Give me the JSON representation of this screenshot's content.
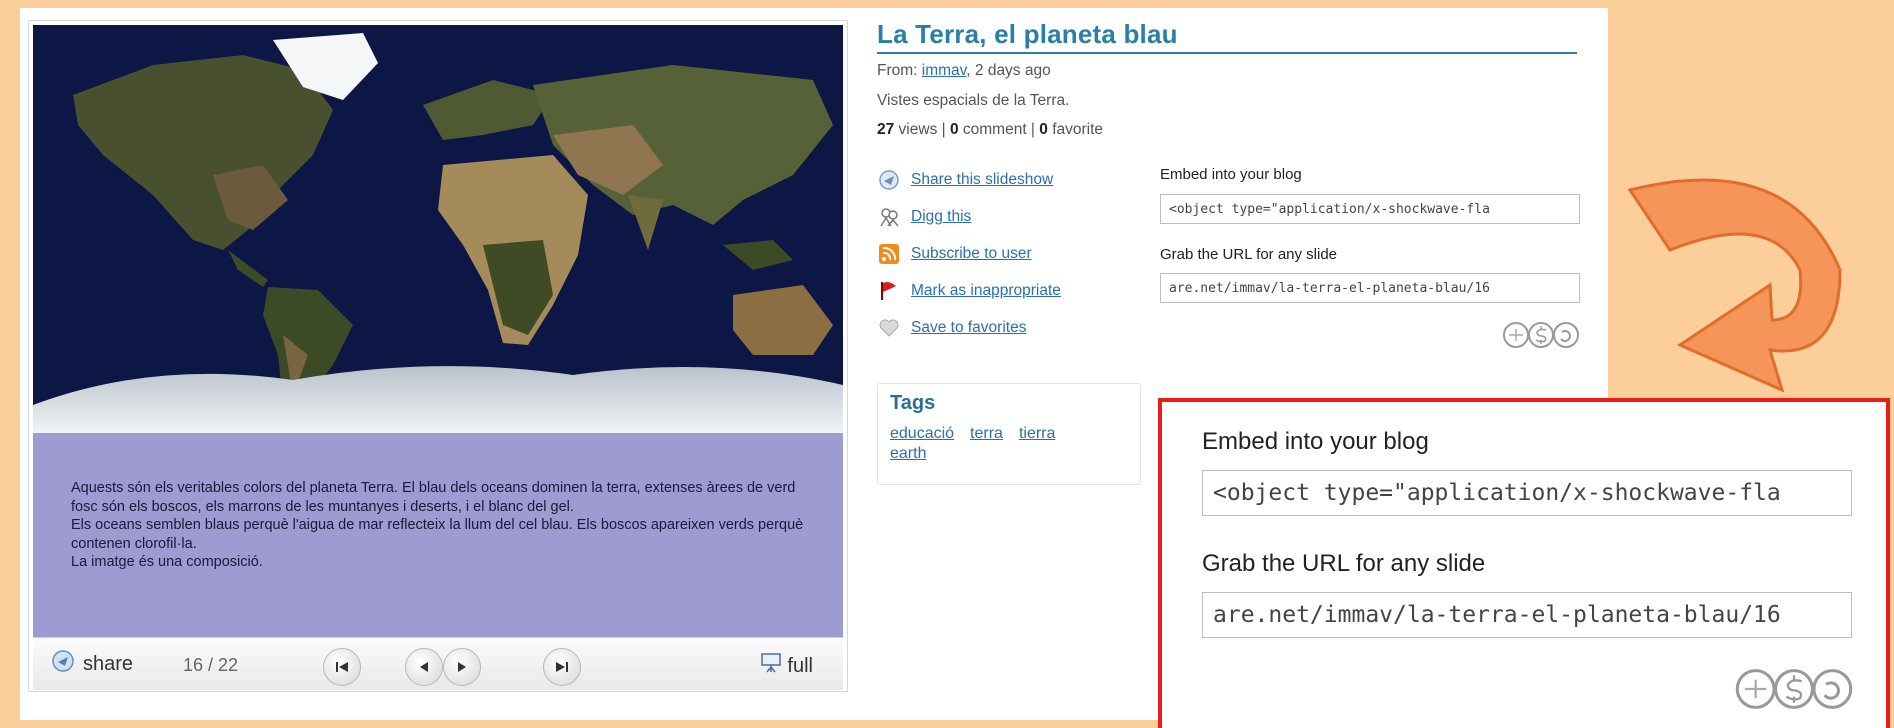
{
  "title": "La Terra, el planeta blau",
  "meta": {
    "from_label": "From:",
    "user": "immav",
    "time": ", 2 days ago",
    "description": "Vistes espacials de la Terra.",
    "views": "27",
    "views_label": " views | ",
    "comments": "0",
    "comments_label": " comment | ",
    "favorites": "0",
    "favorites_label": " favorite"
  },
  "actions": [
    {
      "label": "Share this slideshow",
      "icon": "share-icon"
    },
    {
      "label": "Digg this",
      "icon": "digg-icon"
    },
    {
      "label": "Subscribe to user",
      "icon": "rss-icon"
    },
    {
      "label": "Mark as inappropriate",
      "icon": "flag-icon"
    },
    {
      "label": "Save to favorites",
      "icon": "heart-icon"
    }
  ],
  "embed": {
    "label": "Embed into your blog",
    "value": "<object type=\"application/x-shockwave-fla",
    "url_label": "Grab the URL for any slide",
    "url_value": "are.net/immav/la-terra-el-planeta-blau/16"
  },
  "tags": {
    "title": "Tags",
    "items": [
      "educació",
      "terra",
      "tierra",
      "earth"
    ]
  },
  "slide": {
    "caption": "Aquests són els veritables colors del planeta Terra. El blau dels oceans dominen la terra, extenses àrees de verd fosc són els boscos, els marrons de les muntanyes i deserts, i el blanc del gel.\nEls oceans semblen blaus perquè l'aigua de mar reflecteix la llum del cel blau. Els boscos apareixen verds perquè contenen clorofil·la.\nLa imatge és una composició."
  },
  "player": {
    "share_label": "share",
    "slide_counter": "16 / 22",
    "full_label": "full"
  },
  "license_icon": "creative-commons-by-nc-sa-icon",
  "arrow_icon": "curved-arrow-icon",
  "colors": {
    "background": "#fccf9a",
    "link": "#2b6fb0",
    "title": "#2a7fa6",
    "caption_bg": "#9d9bd1",
    "zoom_border": "#ef1b1b",
    "arrow": "#f5955a"
  }
}
